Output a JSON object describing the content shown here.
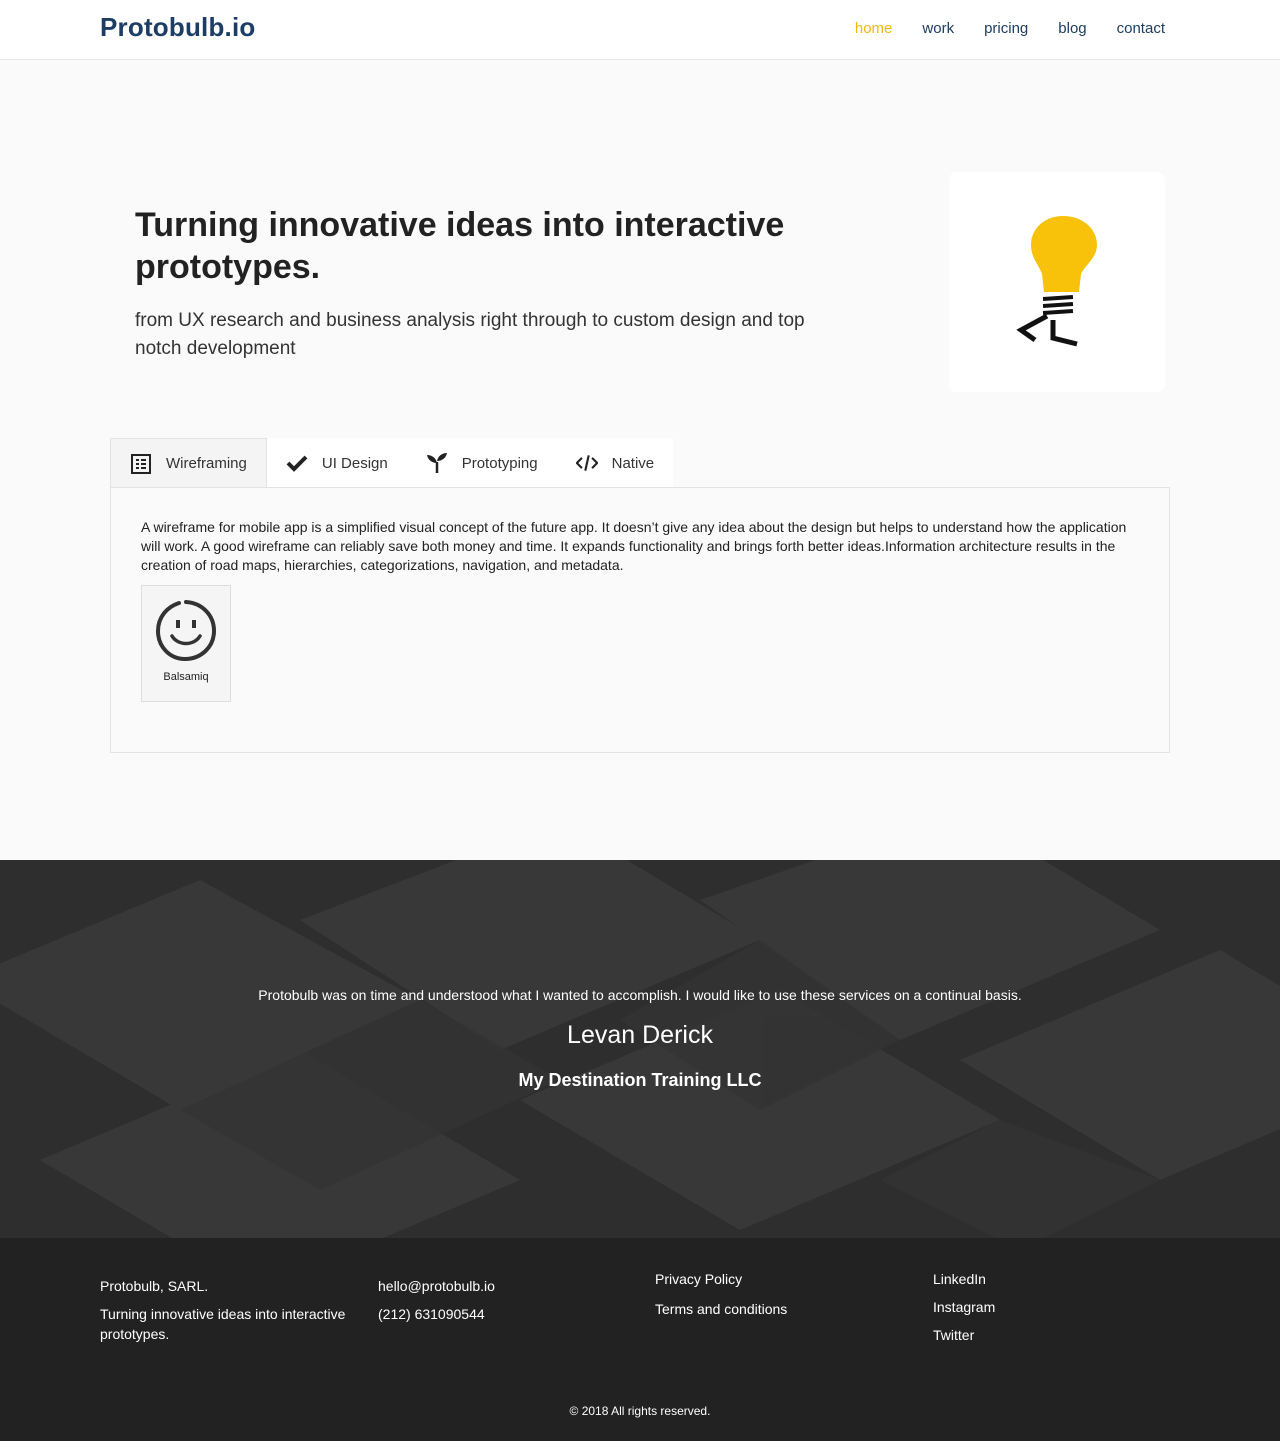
{
  "header": {
    "logo": "Protobulb.io",
    "nav": [
      "home",
      "work",
      "pricing",
      "blog",
      "contact"
    ]
  },
  "hero": {
    "title": "Turning innovative ideas into interactive prototypes.",
    "subtitle": "from UX research and business analysis right through to custom design and top notch development",
    "image_icon": "lightbulb-logo-icon"
  },
  "tabs": {
    "items": [
      {
        "label": "Wireframing",
        "icon": "list-icon",
        "active": true
      },
      {
        "label": "UI Design",
        "icon": "checkmark-icon",
        "active": false
      },
      {
        "label": "Prototyping",
        "icon": "sprout-icon",
        "active": false
      },
      {
        "label": "Native",
        "icon": "code-icon",
        "active": false
      }
    ],
    "panel_text": "A wireframe for mobile app is a simplified visual concept of the future app. It doesn’t give any idea about the design but helps to understand how the application will work. A good wireframe can reliably save both money and time. It expands functionality and brings forth better ideas.Information architecture results in the creation of road maps, hierarchies, categorizations, navigation, and metadata.",
    "tool": {
      "label": "Balsamiq",
      "icon": "smiley-icon"
    }
  },
  "testimonial": {
    "quote": "Protobulb was on time and understood what I wanted to accomplish. I would like to use these services on a continual basis.",
    "name": "Levan Derick",
    "company": "My Destination Training LLC"
  },
  "footer": {
    "company": "Protobulb, SARL.",
    "tagline": "Turning innovative ideas into interactive prototypes.",
    "email": "hello@protobulb.io",
    "phone": "(212) 631090544",
    "legal": [
      "Privacy Policy",
      "Terms and conditions"
    ],
    "social": [
      "LinkedIn",
      "Instagram",
      "Twitter"
    ],
    "copyright": "© 2018 All rights reserved."
  },
  "colors": {
    "brand": "#1c3d64",
    "accent": "#f2b80c",
    "footer_bg": "#222222"
  }
}
